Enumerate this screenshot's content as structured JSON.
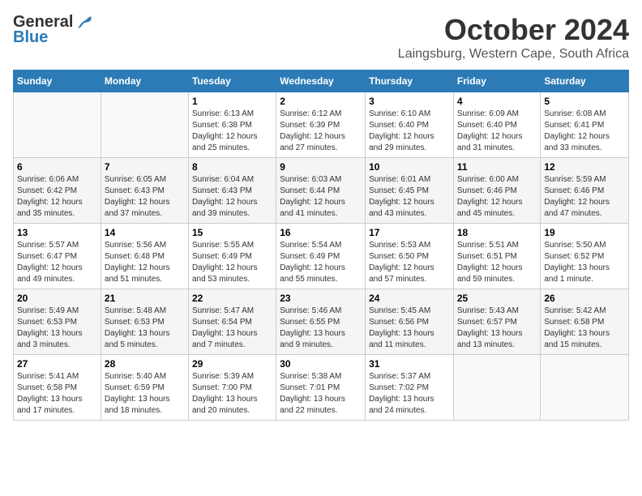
{
  "header": {
    "logo_general": "General",
    "logo_blue": "Blue",
    "month_title": "October 2024",
    "subtitle": "Laingsburg, Western Cape, South Africa"
  },
  "days_of_week": [
    "Sunday",
    "Monday",
    "Tuesday",
    "Wednesday",
    "Thursday",
    "Friday",
    "Saturday"
  ],
  "weeks": [
    [
      {
        "day": "",
        "info": ""
      },
      {
        "day": "",
        "info": ""
      },
      {
        "day": "1",
        "info": "Sunrise: 6:13 AM\nSunset: 6:38 PM\nDaylight: 12 hours\nand 25 minutes."
      },
      {
        "day": "2",
        "info": "Sunrise: 6:12 AM\nSunset: 6:39 PM\nDaylight: 12 hours\nand 27 minutes."
      },
      {
        "day": "3",
        "info": "Sunrise: 6:10 AM\nSunset: 6:40 PM\nDaylight: 12 hours\nand 29 minutes."
      },
      {
        "day": "4",
        "info": "Sunrise: 6:09 AM\nSunset: 6:40 PM\nDaylight: 12 hours\nand 31 minutes."
      },
      {
        "day": "5",
        "info": "Sunrise: 6:08 AM\nSunset: 6:41 PM\nDaylight: 12 hours\nand 33 minutes."
      }
    ],
    [
      {
        "day": "6",
        "info": "Sunrise: 6:06 AM\nSunset: 6:42 PM\nDaylight: 12 hours\nand 35 minutes."
      },
      {
        "day": "7",
        "info": "Sunrise: 6:05 AM\nSunset: 6:43 PM\nDaylight: 12 hours\nand 37 minutes."
      },
      {
        "day": "8",
        "info": "Sunrise: 6:04 AM\nSunset: 6:43 PM\nDaylight: 12 hours\nand 39 minutes."
      },
      {
        "day": "9",
        "info": "Sunrise: 6:03 AM\nSunset: 6:44 PM\nDaylight: 12 hours\nand 41 minutes."
      },
      {
        "day": "10",
        "info": "Sunrise: 6:01 AM\nSunset: 6:45 PM\nDaylight: 12 hours\nand 43 minutes."
      },
      {
        "day": "11",
        "info": "Sunrise: 6:00 AM\nSunset: 6:46 PM\nDaylight: 12 hours\nand 45 minutes."
      },
      {
        "day": "12",
        "info": "Sunrise: 5:59 AM\nSunset: 6:46 PM\nDaylight: 12 hours\nand 47 minutes."
      }
    ],
    [
      {
        "day": "13",
        "info": "Sunrise: 5:57 AM\nSunset: 6:47 PM\nDaylight: 12 hours\nand 49 minutes."
      },
      {
        "day": "14",
        "info": "Sunrise: 5:56 AM\nSunset: 6:48 PM\nDaylight: 12 hours\nand 51 minutes."
      },
      {
        "day": "15",
        "info": "Sunrise: 5:55 AM\nSunset: 6:49 PM\nDaylight: 12 hours\nand 53 minutes."
      },
      {
        "day": "16",
        "info": "Sunrise: 5:54 AM\nSunset: 6:49 PM\nDaylight: 12 hours\nand 55 minutes."
      },
      {
        "day": "17",
        "info": "Sunrise: 5:53 AM\nSunset: 6:50 PM\nDaylight: 12 hours\nand 57 minutes."
      },
      {
        "day": "18",
        "info": "Sunrise: 5:51 AM\nSunset: 6:51 PM\nDaylight: 12 hours\nand 59 minutes."
      },
      {
        "day": "19",
        "info": "Sunrise: 5:50 AM\nSunset: 6:52 PM\nDaylight: 13 hours\nand 1 minute."
      }
    ],
    [
      {
        "day": "20",
        "info": "Sunrise: 5:49 AM\nSunset: 6:53 PM\nDaylight: 13 hours\nand 3 minutes."
      },
      {
        "day": "21",
        "info": "Sunrise: 5:48 AM\nSunset: 6:53 PM\nDaylight: 13 hours\nand 5 minutes."
      },
      {
        "day": "22",
        "info": "Sunrise: 5:47 AM\nSunset: 6:54 PM\nDaylight: 13 hours\nand 7 minutes."
      },
      {
        "day": "23",
        "info": "Sunrise: 5:46 AM\nSunset: 6:55 PM\nDaylight: 13 hours\nand 9 minutes."
      },
      {
        "day": "24",
        "info": "Sunrise: 5:45 AM\nSunset: 6:56 PM\nDaylight: 13 hours\nand 11 minutes."
      },
      {
        "day": "25",
        "info": "Sunrise: 5:43 AM\nSunset: 6:57 PM\nDaylight: 13 hours\nand 13 minutes."
      },
      {
        "day": "26",
        "info": "Sunrise: 5:42 AM\nSunset: 6:58 PM\nDaylight: 13 hours\nand 15 minutes."
      }
    ],
    [
      {
        "day": "27",
        "info": "Sunrise: 5:41 AM\nSunset: 6:58 PM\nDaylight: 13 hours\nand 17 minutes."
      },
      {
        "day": "28",
        "info": "Sunrise: 5:40 AM\nSunset: 6:59 PM\nDaylight: 13 hours\nand 18 minutes."
      },
      {
        "day": "29",
        "info": "Sunrise: 5:39 AM\nSunset: 7:00 PM\nDaylight: 13 hours\nand 20 minutes."
      },
      {
        "day": "30",
        "info": "Sunrise: 5:38 AM\nSunset: 7:01 PM\nDaylight: 13 hours\nand 22 minutes."
      },
      {
        "day": "31",
        "info": "Sunrise: 5:37 AM\nSunset: 7:02 PM\nDaylight: 13 hours\nand 24 minutes."
      },
      {
        "day": "",
        "info": ""
      },
      {
        "day": "",
        "info": ""
      }
    ]
  ]
}
